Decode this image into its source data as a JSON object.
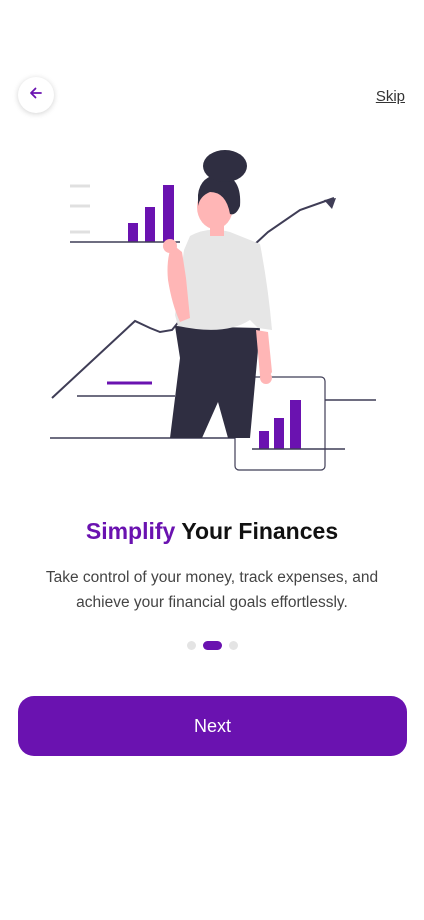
{
  "header": {
    "back_icon": "arrow-left-icon",
    "skip_label": "Skip"
  },
  "illustration": {
    "icon": "finance-growth-illustration"
  },
  "content": {
    "title_accent": "Simplify",
    "title_rest": "Your Finances",
    "subtitle": "Take control of your money, track expenses, and achieve your financial goals effortlessly."
  },
  "pagination": {
    "total": 3,
    "active_index": 1
  },
  "actions": {
    "next_label": "Next"
  },
  "colors": {
    "accent": "#6a12b0",
    "dark": "#2f2e41",
    "skin": "#ffb6b6",
    "shirt": "#e6e6e6"
  }
}
